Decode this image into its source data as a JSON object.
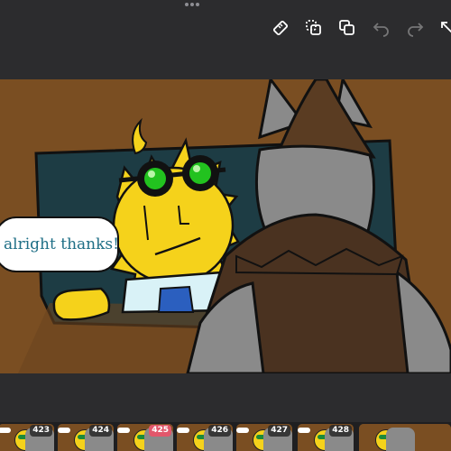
{
  "toolbar": {
    "icons": [
      "ruler-icon",
      "duplicate-frame-icon",
      "copy-icon",
      "undo-icon",
      "redo-icon",
      "expand-icon"
    ]
  },
  "canvas": {
    "speech_text": "alright thanks!"
  },
  "filmstrip": {
    "frames": [
      {
        "number": "423",
        "active": false
      },
      {
        "number": "424",
        "active": false
      },
      {
        "number": "425",
        "active": true
      },
      {
        "number": "426",
        "active": false
      },
      {
        "number": "427",
        "active": false
      },
      {
        "number": "428",
        "active": false
      }
    ]
  },
  "colors": {
    "accent": "#e2576b",
    "background": "#2c2c2e",
    "speech_text": "#1f6f86",
    "room_wall": "#7a4e22",
    "yellow_character": "#f5d21b",
    "goggle_green": "#22c21f",
    "wolf_gray": "#8a8a8a",
    "coat_brown": "#4a3220"
  }
}
